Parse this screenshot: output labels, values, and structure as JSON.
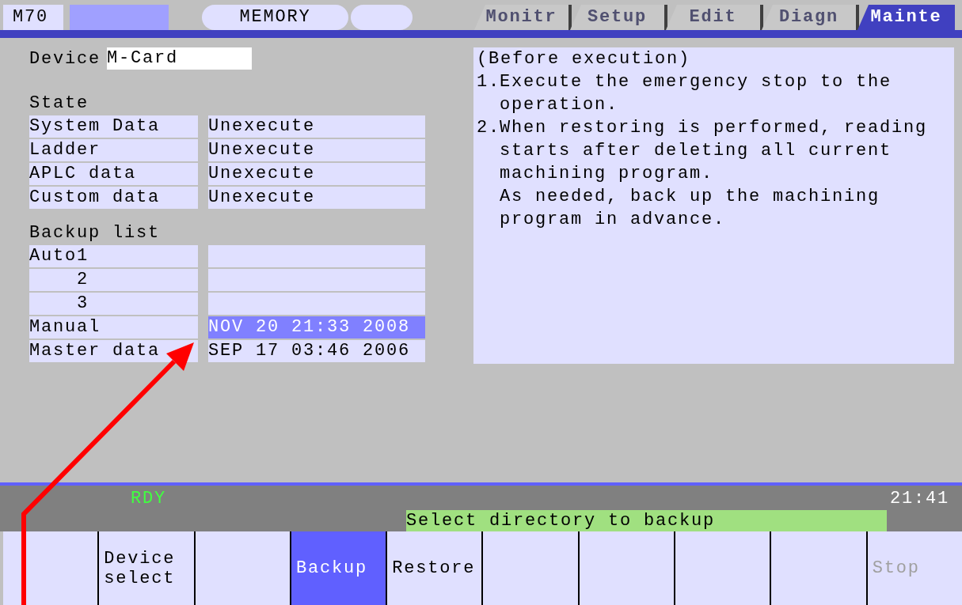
{
  "header": {
    "model": "M70",
    "mode": "MEMORY",
    "tabs": [
      {
        "label": "Monitr",
        "selected": false
      },
      {
        "label": "Setup",
        "selected": false
      },
      {
        "label": "Edit",
        "selected": false
      },
      {
        "label": "Diagn",
        "selected": false
      },
      {
        "label": "Mainte",
        "selected": true
      }
    ]
  },
  "device": {
    "label": "Device",
    "value": "M-Card"
  },
  "state": {
    "title": "State",
    "rows": [
      {
        "name": "System Data",
        "value": "Unexecute"
      },
      {
        "name": "Ladder",
        "value": "Unexecute"
      },
      {
        "name": "APLC data",
        "value": "Unexecute"
      },
      {
        "name": "Custom data",
        "value": "Unexecute"
      }
    ]
  },
  "backup_list": {
    "title": "Backup list",
    "rows": [
      {
        "name": "Auto1",
        "selected": false
      },
      {
        "name": "2",
        "selected": false
      },
      {
        "name": "3",
        "selected": false
      },
      {
        "name": "Manual",
        "value": "NOV 20 21:33 2008",
        "selected": true
      },
      {
        "name": "Master data",
        "value": "SEP 17 03:46 2006",
        "selected": false
      }
    ]
  },
  "notes": {
    "heading": "(Before execution)",
    "items": [
      {
        "number": "1.",
        "lines": [
          "Execute the emergency stop to the",
          "operation."
        ]
      },
      {
        "number": "2.",
        "lines": [
          "When restoring is performed, reading",
          "starts after deleting all current",
          "machining program.",
          "As needed, back up the machining",
          "program in advance."
        ]
      }
    ]
  },
  "status": {
    "state": "RDY",
    "time": "21:41",
    "message": "Select directory to backup"
  },
  "softkeys": [
    {
      "selected": false
    },
    {
      "label": "Device select",
      "selected": false,
      "disabled": false
    },
    {
      "selected": false
    },
    {
      "label": "Backup",
      "selected": true,
      "disabled": false
    },
    {
      "label": "Restore",
      "selected": false,
      "disabled": false
    },
    {
      "selected": false
    },
    {
      "selected": false
    },
    {
      "selected": false
    },
    {
      "selected": false
    },
    {
      "label": "Stop",
      "selected": false,
      "disabled": true
    }
  ]
}
